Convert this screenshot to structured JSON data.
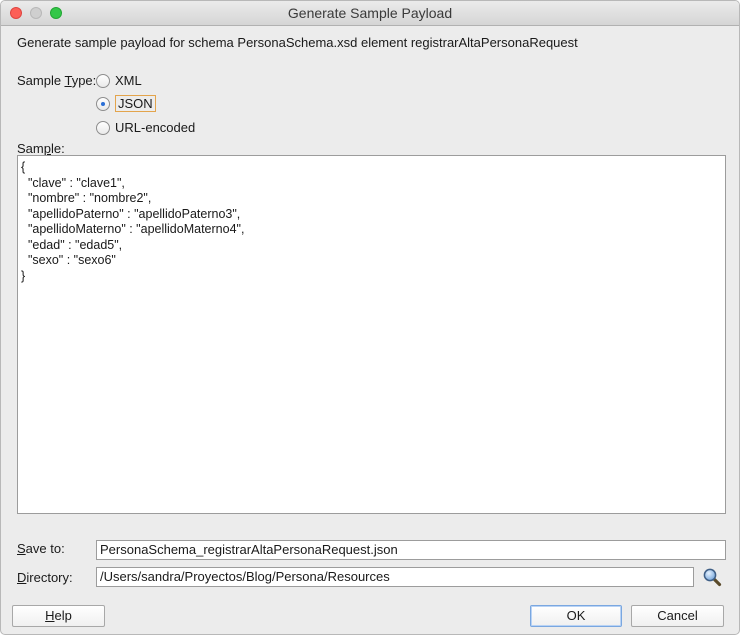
{
  "window": {
    "title": "Generate Sample Payload"
  },
  "description": "Generate sample payload for schema PersonaSchema.xsd element registrarAltaPersonaRequest",
  "sample_type": {
    "label_pre": "Sample ",
    "label_mnemonic": "T",
    "label_post": "ype:",
    "options": [
      {
        "label": "XML",
        "selected": false
      },
      {
        "label": "JSON",
        "selected": true
      },
      {
        "label": "URL-encoded",
        "selected": false
      }
    ]
  },
  "sample": {
    "label_pre": "Sam",
    "label_mnemonic": "p",
    "label_post": "le:",
    "text": "{\n  \"clave\" : \"clave1\",\n  \"nombre\" : \"nombre2\",\n  \"apellidoPaterno\" : \"apellidoPaterno3\",\n  \"apellidoMaterno\" : \"apellidoMaterno4\",\n  \"edad\" : \"edad5\",\n  \"sexo\" : \"sexo6\"\n}"
  },
  "save_to": {
    "label_mnemonic": "S",
    "label_post": "ave to:",
    "value": "PersonaSchema_registrarAltaPersonaRequest.json"
  },
  "directory": {
    "label_mnemonic": "D",
    "label_post": "irectory:",
    "value": "/Users/sandra/Proyectos/Blog/Persona/Resources"
  },
  "buttons": {
    "help_mnemonic": "H",
    "help_post": "elp",
    "ok": "OK",
    "cancel": "Cancel"
  },
  "icons": {
    "browse": "magnifier-icon"
  }
}
